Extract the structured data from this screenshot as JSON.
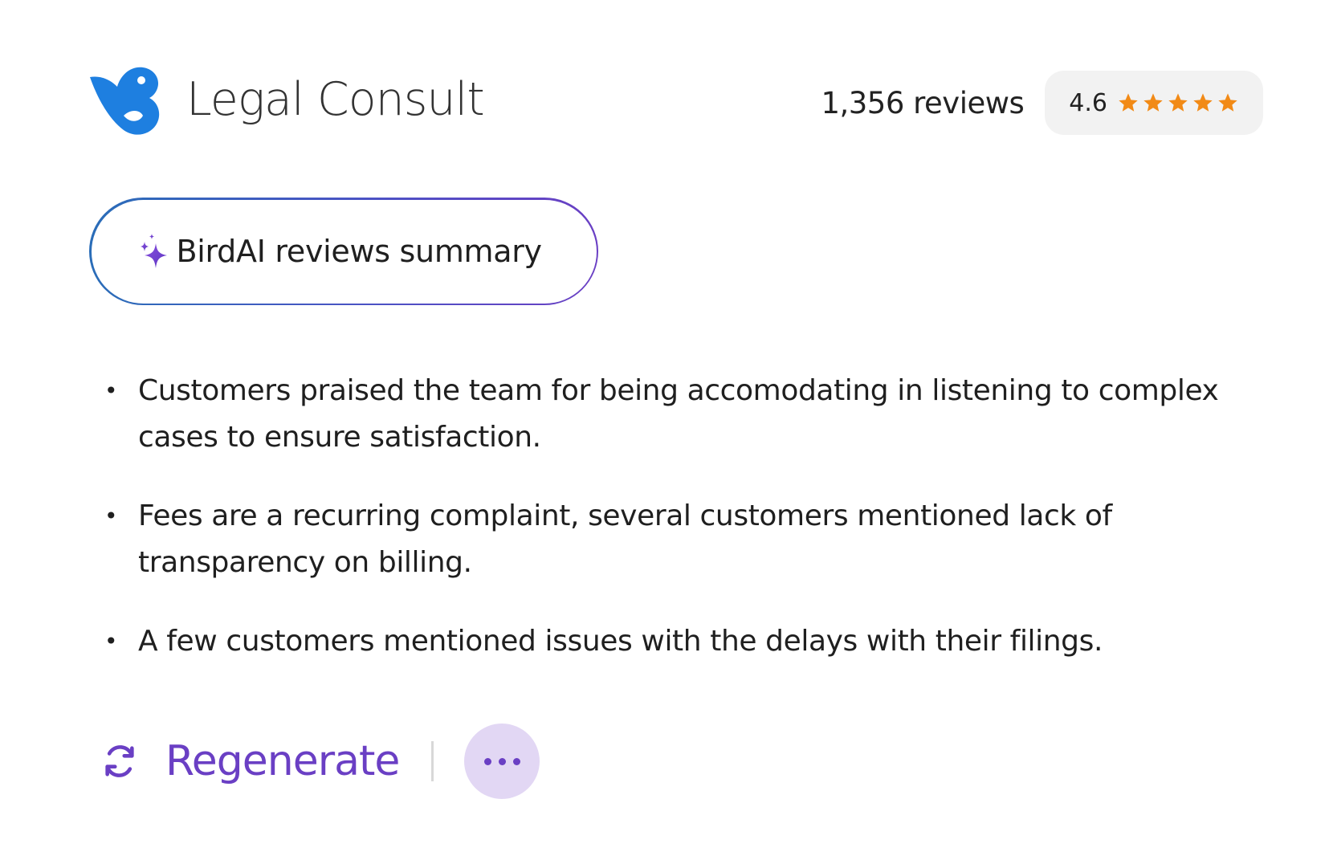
{
  "brand": {
    "name": "Legal Consult",
    "logo_icon": "bird-logo-icon",
    "logo_color": "#1e7fe0"
  },
  "rating": {
    "review_count": "1,356 reviews",
    "value": "4.6",
    "stars": 5,
    "star_color": "#f28a16"
  },
  "ai_summary": {
    "label": "BirdAI reviews summary",
    "icon": "sparkle-icon",
    "accent": "#6a3fc4"
  },
  "summary_points": [
    "Customers praised the team for being accomodating in listening to complex cases to ensure satisfaction.",
    "Fees are a recurring complaint, several customers mentioned lack of transparency on billing.",
    "A few customers mentioned issues with the delays with their filings."
  ],
  "actions": {
    "regenerate_label": "Regenerate",
    "regenerate_icon": "refresh-icon",
    "more_icon": "more-horizontal-icon"
  }
}
